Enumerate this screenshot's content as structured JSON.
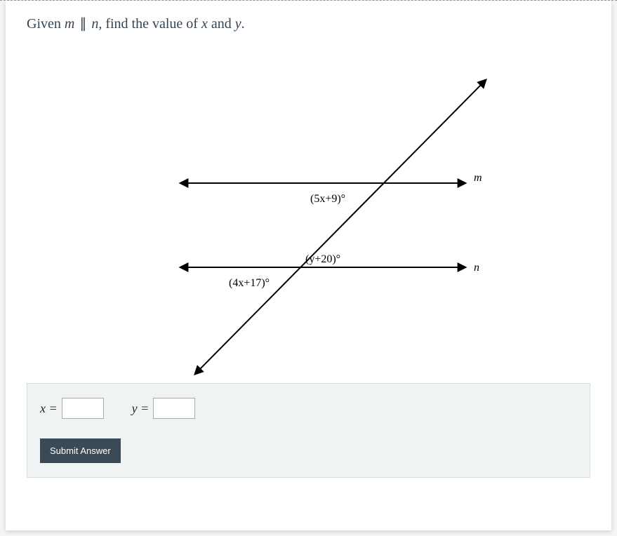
{
  "problem": {
    "prefix": "Given ",
    "var_m": "m",
    "parallel": "∥",
    "var_n": "n",
    "suffix": ", find the value of ",
    "var_x": "x",
    "and": " and ",
    "var_y": "y",
    "period": "."
  },
  "diagram": {
    "line_m_label": "m",
    "line_n_label": "n",
    "angle1": "(5x+9)°",
    "angle2": "(y+20)°",
    "angle3": "(4x+17)°"
  },
  "answers": {
    "x_label": "x =",
    "y_label": "y =",
    "x_value": "",
    "y_value": ""
  },
  "submit_label": "Submit Answer"
}
